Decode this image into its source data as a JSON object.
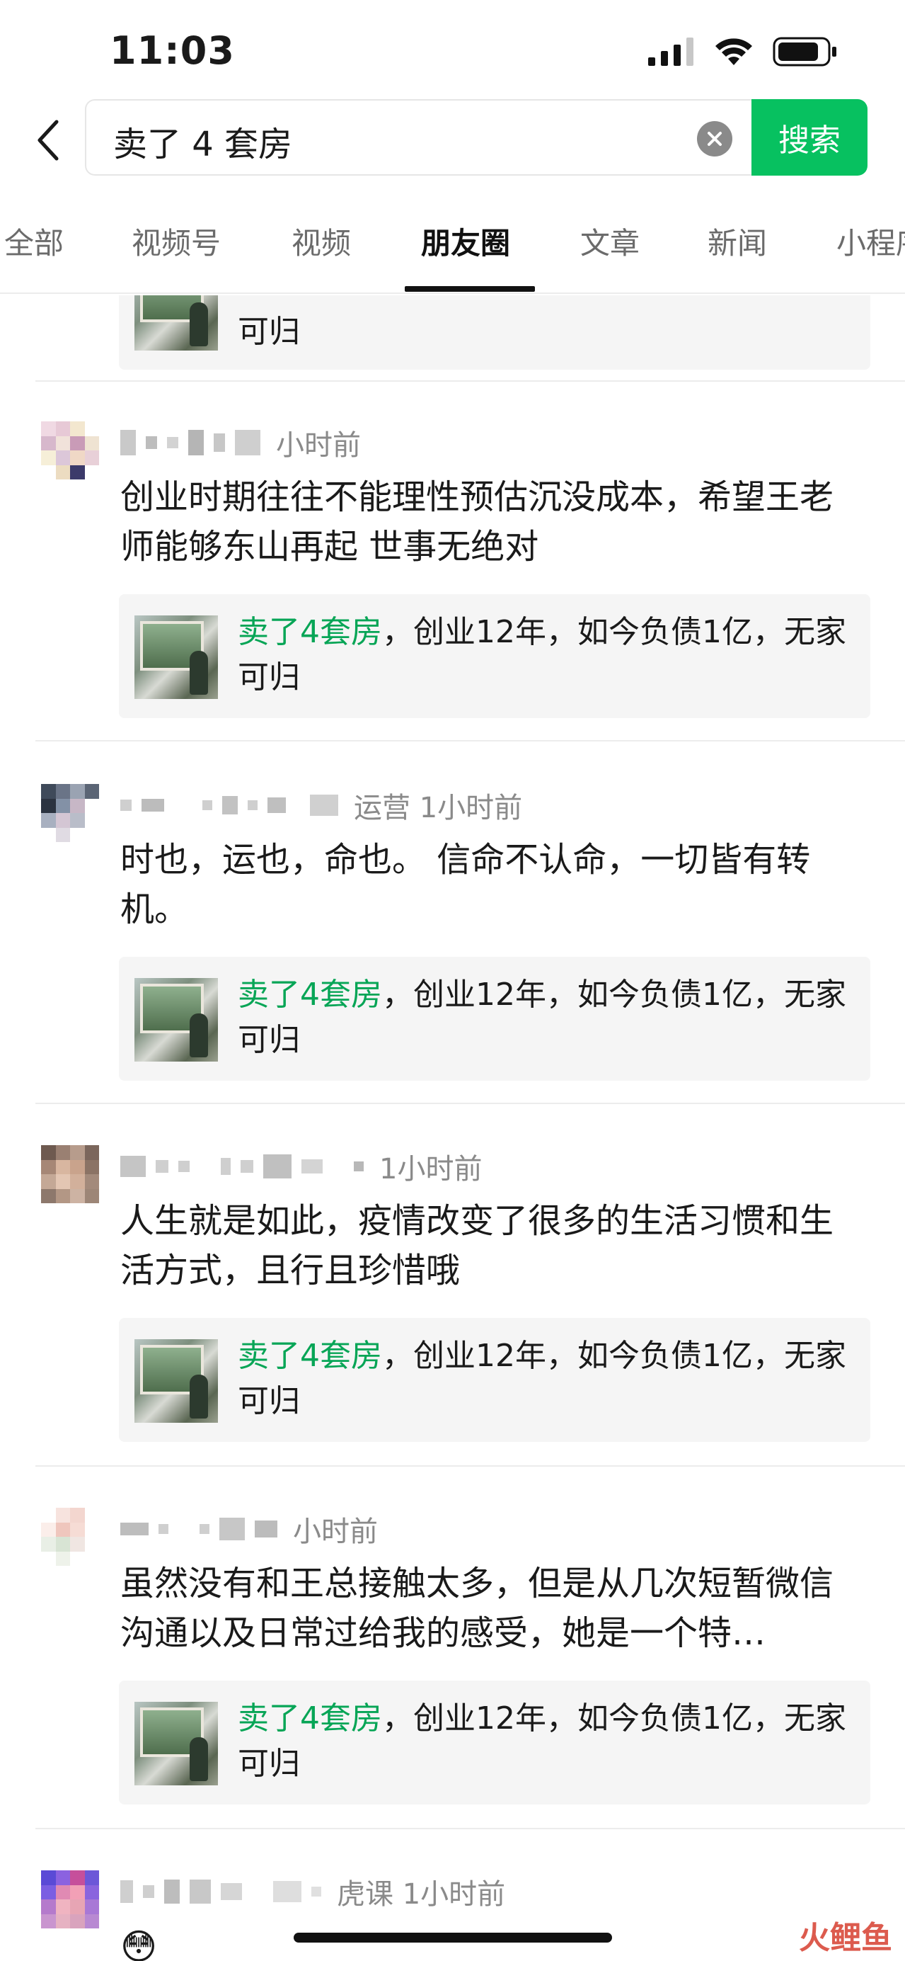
{
  "status_bar": {
    "time": "11:03"
  },
  "search": {
    "query": "卖了 4 套房",
    "button_label": "搜索"
  },
  "tabs": [
    {
      "label": "全部",
      "active": false
    },
    {
      "label": "视频号",
      "active": false
    },
    {
      "label": "视频",
      "active": false
    },
    {
      "label": "朋友圈",
      "active": true
    },
    {
      "label": "文章",
      "active": false
    },
    {
      "label": "新闻",
      "active": false
    },
    {
      "label": "小程序",
      "active": false
    }
  ],
  "shared_article": {
    "highlight": "卖了4套房",
    "rest": "，创业12年，如今负债1亿，无家可归",
    "partial_top": "可归"
  },
  "posts": [
    {
      "meta": "小时前",
      "text": "创业时期往往不能理性预估沉没成本，希望王老师能够东山再起 世事无绝对"
    },
    {
      "meta": "运营  1小时前",
      "text": "时也，运也，命也。 信命不认命，一切皆有转机。"
    },
    {
      "meta": "1小时前",
      "text": "人生就是如此，疫情改变了很多的生活习惯和生活方式，且行且珍惜哦"
    },
    {
      "meta": "小时前",
      "text": "虽然没有和王总接触太多，但是从几次短暂微信沟通以及日常过给我的感受，她是一个特…"
    },
    {
      "meta": "虎课  1小时前",
      "text": ""
    }
  ],
  "colors": {
    "accent": "#07c160",
    "highlight": "#07a556",
    "watermark": "#d94a3b"
  },
  "watermark": {
    "line1": "火鲤鱼"
  },
  "emoji": "😳"
}
